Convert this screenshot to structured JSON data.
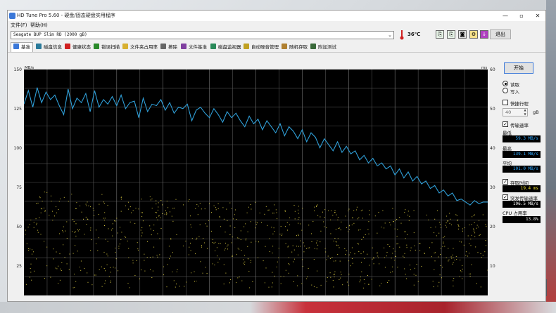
{
  "window": {
    "title": "HD Tune Pro 5.60 - 硬盘/固态硬盘实用程序",
    "controls": {
      "minimize": "—",
      "maximize": "▫",
      "close": "✕"
    }
  },
  "menu": {
    "file": "文件(F)",
    "help": "帮助(H)"
  },
  "toolbar": {
    "drive": "Seagate BUP Slim RD (2000 gB)",
    "temperature": "36℃",
    "exit_label": "退出"
  },
  "tabs": [
    {
      "label": "基准",
      "color": "#3b78d8"
    },
    {
      "label": "磁盘信息",
      "color": "#2a7a9a"
    },
    {
      "label": "健康状态",
      "color": "#d02020"
    },
    {
      "label": "错误扫描",
      "color": "#2a8a2a"
    },
    {
      "label": "文件夹占用率",
      "color": "#d8b030"
    },
    {
      "label": "擦除",
      "color": "#666666"
    },
    {
      "label": "文件基准",
      "color": "#8040a0"
    },
    {
      "label": "磁盘监视器",
      "color": "#2a8a5a"
    },
    {
      "label": "自动噪音管理",
      "color": "#c0a020"
    },
    {
      "label": "随机存取",
      "color": "#b08030"
    },
    {
      "label": "附加测试",
      "color": "#3a6a3a"
    }
  ],
  "side": {
    "start_label": "开始",
    "read_label": "读取",
    "write_label": "写入",
    "short_stroke_label": "快捷行程",
    "short_stroke_value": "40",
    "short_stroke_unit": "gB",
    "transfer_rate_label": "传输速率",
    "min_label": "最低",
    "min_value": "59.3 MB/s",
    "max_label": "最高",
    "max_value": "139.1 MB/s",
    "avg_label": "平均",
    "avg_value": "101.0 MB/s",
    "access_time_label": "存取时间",
    "access_time_value": "19.4 ms",
    "burst_rate_label": "突发传输速率",
    "burst_rate_value": "196.5 MB/s",
    "cpu_label": "CPU 占用率",
    "cpu_value": "13.8%",
    "value_color_speed": "#2da8ff",
    "value_color_access": "#f0e030",
    "value_color_white": "#ffffff"
  },
  "chart_data": {
    "type": "line",
    "left_unit": "MB/s",
    "right_unit": "ms",
    "left_ticks": [
      "150",
      "125",
      "100",
      "75",
      "50",
      "25"
    ],
    "right_ticks": [
      "60",
      "50",
      "40",
      "30",
      "20",
      "10"
    ],
    "left_ylim": [
      0,
      150
    ],
    "right_ylim": [
      0,
      60
    ],
    "grid": true,
    "background": "#000000",
    "grid_color": "#555555",
    "series": [
      {
        "color": "#2f9fd8",
        "x_range": [
          0,
          100
        ],
        "values": [
          127,
          136,
          125,
          138,
          128,
          135,
          130,
          133,
          126,
          120,
          137,
          124,
          131,
          128,
          134,
          122,
          136,
          125,
          130,
          127,
          132,
          126,
          133,
          124,
          128,
          129,
          118,
          131,
          122,
          127,
          126,
          130,
          123,
          128,
          121,
          125,
          124,
          127,
          116,
          123,
          125,
          121,
          118,
          124,
          120,
          115,
          122,
          118,
          121,
          116,
          112,
          119,
          114,
          117,
          110,
          116,
          112,
          108,
          114,
          106,
          112,
          109,
          104,
          110,
          102,
          108,
          105,
          98,
          104,
          100,
          96,
          102,
          95,
          99,
          94,
          96,
          90,
          93,
          88,
          91,
          86,
          88,
          84,
          86,
          80,
          84,
          78,
          82,
          76,
          79,
          74,
          76,
          71,
          73,
          68,
          70,
          66,
          68,
          63,
          64,
          62,
          60,
          63,
          61,
          62,
          62
        ]
      }
    ],
    "scatter_series": {
      "color": "#d8c840",
      "note": "access time (ms), right axis",
      "y_range_ms": [
        2,
        28
      ]
    }
  }
}
